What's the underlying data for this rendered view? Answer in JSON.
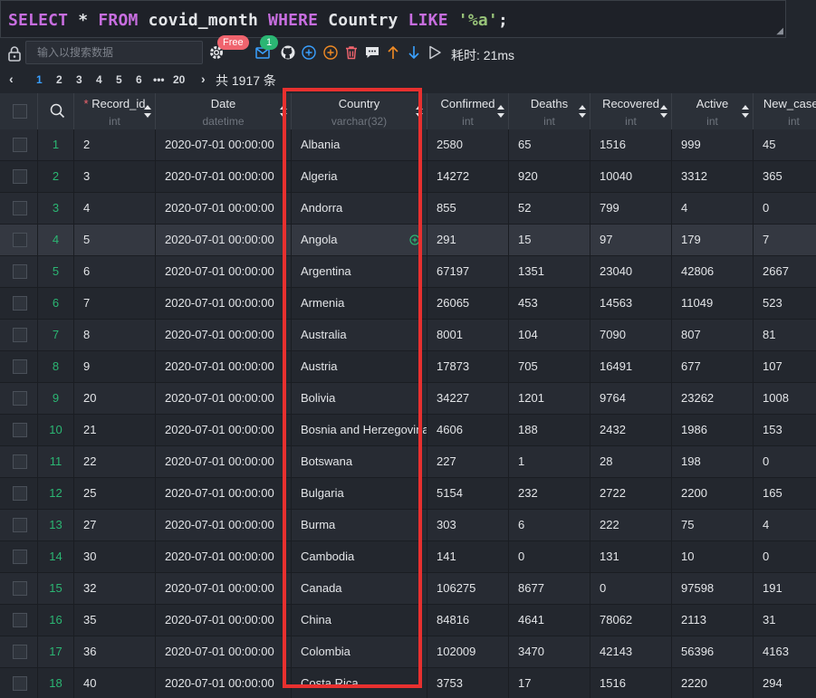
{
  "sql": {
    "kw_select": "SELECT",
    "star": "*",
    "kw_from": "FROM",
    "table": "covid_month",
    "kw_where": "WHERE",
    "column": "Country",
    "kw_like": "LIKE",
    "pattern": "'%a'",
    "terminator": ";"
  },
  "toolbar": {
    "search_placeholder": "输入以搜索数据",
    "free_badge": "Free",
    "notify_count": "1",
    "timer": "耗时: 21ms",
    "icons": [
      "lock-icon",
      "gear-icon",
      "mail-icon",
      "github-icon",
      "add-row-icon",
      "add-icon",
      "delete-icon",
      "comment-icon",
      "arrow-up-icon",
      "arrow-down-icon",
      "run-icon"
    ]
  },
  "pagination": {
    "pages": [
      "1",
      "2",
      "3",
      "4",
      "5",
      "6",
      "•••",
      "20"
    ],
    "active_page": "1",
    "total": "共 1917 条"
  },
  "columns": [
    {
      "name": "Record_id",
      "type": "int",
      "required": true
    },
    {
      "name": "Date",
      "type": "datetime",
      "required": false
    },
    {
      "name": "Country",
      "type": "varchar(32)",
      "required": false
    },
    {
      "name": "Confirmed",
      "type": "int",
      "required": false
    },
    {
      "name": "Deaths",
      "type": "int",
      "required": false
    },
    {
      "name": "Recovered",
      "type": "int",
      "required": false
    },
    {
      "name": "Active",
      "type": "int",
      "required": false
    },
    {
      "name": "New_cases",
      "type": "int",
      "required": false
    }
  ],
  "rows": [
    [
      "1",
      "2",
      "2020-07-01 00:00:00",
      "Albania",
      "2580",
      "65",
      "1516",
      "999",
      "45"
    ],
    [
      "2",
      "3",
      "2020-07-01 00:00:00",
      "Algeria",
      "14272",
      "920",
      "10040",
      "3312",
      "365"
    ],
    [
      "3",
      "4",
      "2020-07-01 00:00:00",
      "Andorra",
      "855",
      "52",
      "799",
      "4",
      "0"
    ],
    [
      "4",
      "5",
      "2020-07-01 00:00:00",
      "Angola",
      "291",
      "15",
      "97",
      "179",
      "7"
    ],
    [
      "5",
      "6",
      "2020-07-01 00:00:00",
      "Argentina",
      "67197",
      "1351",
      "23040",
      "42806",
      "2667"
    ],
    [
      "6",
      "7",
      "2020-07-01 00:00:00",
      "Armenia",
      "26065",
      "453",
      "14563",
      "11049",
      "523"
    ],
    [
      "7",
      "8",
      "2020-07-01 00:00:00",
      "Australia",
      "8001",
      "104",
      "7090",
      "807",
      "81"
    ],
    [
      "8",
      "9",
      "2020-07-01 00:00:00",
      "Austria",
      "17873",
      "705",
      "16491",
      "677",
      "107"
    ],
    [
      "9",
      "20",
      "2020-07-01 00:00:00",
      "Bolivia",
      "34227",
      "1201",
      "9764",
      "23262",
      "1008"
    ],
    [
      "10",
      "21",
      "2020-07-01 00:00:00",
      "Bosnia and Herzegovina",
      "4606",
      "188",
      "2432",
      "1986",
      "153"
    ],
    [
      "11",
      "22",
      "2020-07-01 00:00:00",
      "Botswana",
      "227",
      "1",
      "28",
      "198",
      "0"
    ],
    [
      "12",
      "25",
      "2020-07-01 00:00:00",
      "Bulgaria",
      "5154",
      "232",
      "2722",
      "2200",
      "165"
    ],
    [
      "13",
      "27",
      "2020-07-01 00:00:00",
      "Burma",
      "303",
      "6",
      "222",
      "75",
      "4"
    ],
    [
      "14",
      "30",
      "2020-07-01 00:00:00",
      "Cambodia",
      "141",
      "0",
      "131",
      "10",
      "0"
    ],
    [
      "15",
      "32",
      "2020-07-01 00:00:00",
      "Canada",
      "106275",
      "8677",
      "0",
      "97598",
      "191"
    ],
    [
      "16",
      "35",
      "2020-07-01 00:00:00",
      "China",
      "84816",
      "4641",
      "78062",
      "2113",
      "31"
    ],
    [
      "17",
      "36",
      "2020-07-01 00:00:00",
      "Colombia",
      "102009",
      "3470",
      "42143",
      "56396",
      "4163"
    ],
    [
      "18",
      "40",
      "2020-07-01 00:00:00",
      "Costa Rica",
      "3753",
      "17",
      "1516",
      "2220",
      "294"
    ]
  ],
  "hovered_row": 4,
  "colors": {
    "accent": "#3aa0ff",
    "highlight": "#e8302f",
    "row_number": "#2bb673",
    "keyword": "#c86ee0",
    "string": "#98c379"
  }
}
